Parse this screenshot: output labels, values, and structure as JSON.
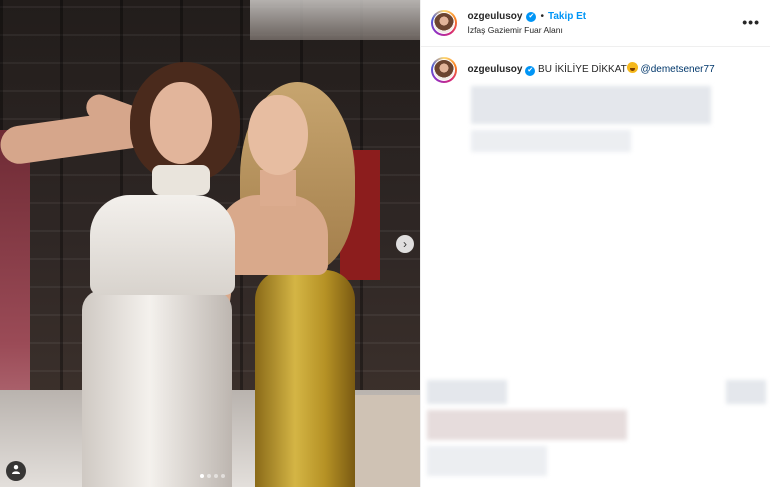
{
  "post": {
    "header": {
      "username": "ozgeulusoy",
      "verified_mark": "✔",
      "separator": "•",
      "follow_label": "Takip Et",
      "location": "İzfaş Gaziemir Fuar Alanı",
      "more_label": "•••"
    },
    "caption": {
      "username": "ozgeulusoy",
      "text": "BU İKİLİYE DİKKAT",
      "emoji_icon": "face-emoji-icon",
      "mention": "@demetsener77"
    },
    "media": {
      "carousel_dots": 4,
      "active_dot": 1,
      "next_icon": "›",
      "tag_icon": "person-tag-icon"
    },
    "colors": {
      "accent": "#0095f6",
      "text": "#262626",
      "mention": "#00376b"
    }
  }
}
